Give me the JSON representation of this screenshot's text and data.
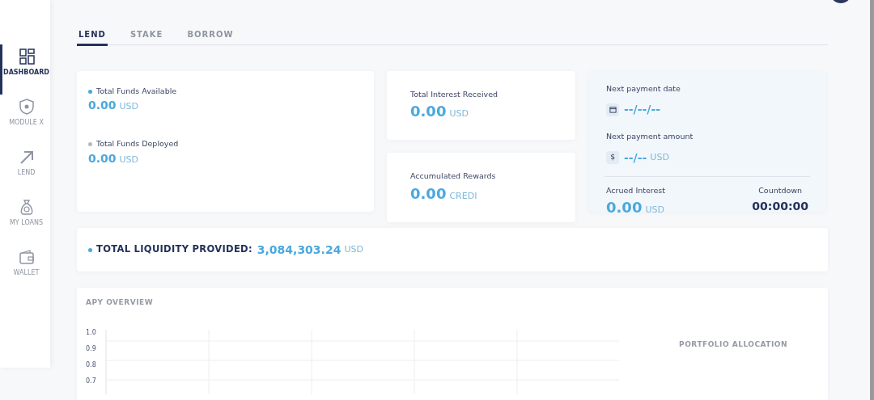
{
  "sidebar": {
    "items": [
      {
        "label": "DASHBOARD",
        "selected": true
      },
      {
        "label": "MODULE X",
        "selected": false
      },
      {
        "label": "LEND",
        "selected": false
      },
      {
        "label": "MY LOANS",
        "selected": false
      },
      {
        "label": "WALLET",
        "selected": false
      }
    ]
  },
  "tabs": [
    {
      "label": "LEND",
      "selected": true
    },
    {
      "label": "STAKE",
      "selected": false
    },
    {
      "label": "BORROW",
      "selected": false
    }
  ],
  "funds": [
    {
      "label": "Total Funds Available",
      "value": "0.00",
      "unit": "USD",
      "color": "#4aa8dd"
    },
    {
      "label": "Total Funds Deployed",
      "value": "0.00",
      "unit": "USD",
      "color": "#b5b9c0"
    }
  ],
  "interest": {
    "label": "Total Interest Received",
    "value": "0.00",
    "unit": "USD"
  },
  "rewards": {
    "label": "Accumulated Rewards",
    "value": "0.00",
    "unit": "CREDI"
  },
  "payment": {
    "date_label": "Next payment date",
    "date": "--/--/--",
    "amount_label": "Next payment amount",
    "amount_symbol": "$",
    "amount": "--/--",
    "amount_unit": "USD",
    "accrued_label": "Acrued Interest",
    "accrued": "0.00",
    "accrued_unit": "USD",
    "countdown_label": "Countdown",
    "countdown": "00:00:00"
  },
  "liquidity": {
    "label": "TOTAL LIQUIDITY PROVIDED:",
    "value": "3,084,303.24",
    "unit": "USD"
  },
  "apy": {
    "title": "APY OVERVIEW",
    "y_labels": [
      "1.0",
      "0.9",
      "0.8",
      "0.7"
    ]
  },
  "portfolio": {
    "title": "PORTFOLIO ALLOCATION"
  }
}
